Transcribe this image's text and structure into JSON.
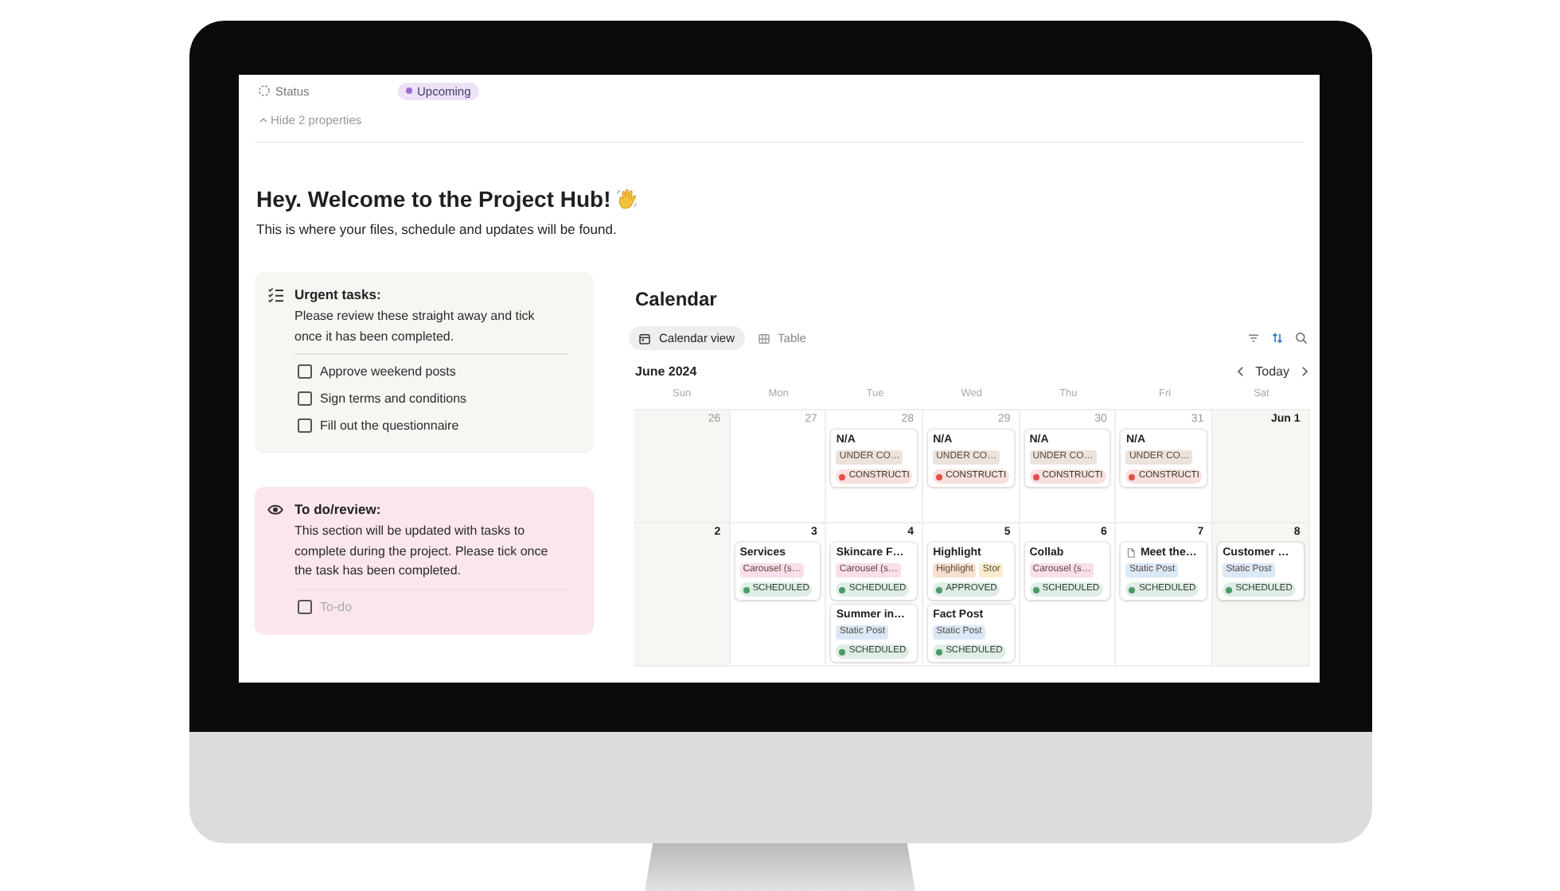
{
  "properties": {
    "status": {
      "label": "Status",
      "value": "Upcoming",
      "color": "#9a6dd7"
    },
    "toggle": "Hide 2 properties"
  },
  "hero": {
    "heading": "Hey. Welcome to the Project Hub!",
    "subtitle": "This is where your files, schedule and updates will be found."
  },
  "callouts": [
    {
      "kind": "urgent",
      "title": "Urgent tasks:",
      "text": "Please review these straight away and tick once it  has been completed.",
      "items": [
        {
          "label": "Approve weekend posts",
          "checked": false,
          "kind": "task"
        },
        {
          "label": "Sign terms and conditions",
          "checked": false,
          "kind": "task"
        },
        {
          "label": "Fill out the questionnaire",
          "checked": false,
          "kind": "task"
        }
      ]
    },
    {
      "kind": "review",
      "title": "To do/review:",
      "text": "This section will be updated with tasks to complete during the project. Please tick once the task has been completed.",
      "items": [
        {
          "label": "To-do",
          "checked": false,
          "kind": "placeholder"
        }
      ]
    }
  ],
  "calendar": {
    "title": "Calendar",
    "views": [
      {
        "label": "Calendar view",
        "kind": "calendar",
        "selected": true
      },
      {
        "label": "Table",
        "kind": "table",
        "selected": false
      }
    ],
    "month": "June 2024",
    "today": "Today",
    "weekdays": [
      "Sun",
      "Mon",
      "Tue",
      "Wed",
      "Thu",
      "Fri",
      "Sat"
    ],
    "weeks": [
      [
        {
          "day": "26",
          "in_month": false,
          "weekend": true
        },
        {
          "day": "27",
          "in_month": false,
          "weekend": false
        },
        {
          "day": "28",
          "in_month": false,
          "weekend": false,
          "events": [
            {
              "title": "N/A",
              "tags": [
                {
                  "label": "UNDER CO…",
                  "color": "#ebe3dc"
                }
              ],
              "status": {
                "label": "CONSTRUCTI",
                "color": "#e0524c"
              }
            }
          ]
        },
        {
          "day": "29",
          "in_month": false,
          "weekend": false,
          "events": [
            {
              "title": "N/A",
              "tags": [
                {
                  "label": "UNDER CO…",
                  "color": "#ebe3dc"
                }
              ],
              "status": {
                "label": "CONSTRUCTI",
                "color": "#e0524c"
              }
            }
          ]
        },
        {
          "day": "30",
          "in_month": false,
          "weekend": false,
          "events": [
            {
              "title": "N/A",
              "tags": [
                {
                  "label": "UNDER CO…",
                  "color": "#ebe3dc"
                }
              ],
              "status": {
                "label": "CONSTRUCTI",
                "color": "#e0524c"
              }
            }
          ]
        },
        {
          "day": "31",
          "in_month": false,
          "weekend": false,
          "events": [
            {
              "title": "N/A",
              "tags": [
                {
                  "label": "UNDER CO…",
                  "color": "#ebe3dc"
                }
              ],
              "status": {
                "label": "CONSTRUCTI",
                "color": "#e0524c"
              }
            }
          ]
        },
        {
          "day": "Jun 1",
          "in_month": true,
          "weekend": true
        }
      ],
      [
        {
          "day": "2",
          "in_month": true,
          "weekend": true
        },
        {
          "day": "3",
          "in_month": true,
          "weekend": false,
          "events": [
            {
              "title": "Services",
              "tags": [
                {
                  "label": "Carousel (s…",
                  "color": "#f9dfe7"
                }
              ],
              "status": {
                "label": "SCHEDULED",
                "color": "#4c9a6a"
              }
            }
          ]
        },
        {
          "day": "4",
          "in_month": true,
          "weekend": false,
          "events": [
            {
              "title": "Skincare F…",
              "tags": [
                {
                  "label": "Carousel (s…",
                  "color": "#f9dfe7"
                }
              ],
              "status": {
                "label": "SCHEDULED",
                "color": "#4c9a6a"
              }
            },
            {
              "title": "Summer in…",
              "tags": [
                {
                  "label": "Static Post",
                  "color": "#dbe9f7"
                }
              ],
              "status": {
                "label": "SCHEDULED",
                "color": "#4c9a6a"
              }
            }
          ]
        },
        {
          "day": "5",
          "in_month": true,
          "weekend": false,
          "events": [
            {
              "title": "Highlight",
              "tags": [
                {
                  "label": "Highlight",
                  "color": "#f8e0cf"
                },
                {
                  "label": "Stor",
                  "color": "#faedcc"
                }
              ],
              "status": {
                "label": "APPROVED",
                "color": "#4c9a6a"
              }
            },
            {
              "title": "Fact Post",
              "tags": [
                {
                  "label": "Static Post",
                  "color": "#dbe9f7"
                }
              ],
              "status": {
                "label": "SCHEDULED",
                "color": "#4c9a6a"
              }
            }
          ]
        },
        {
          "day": "6",
          "in_month": true,
          "weekend": false,
          "events": [
            {
              "title": "Collab",
              "tags": [
                {
                  "label": "Carousel (s…",
                  "color": "#f9dfe7"
                }
              ],
              "status": {
                "label": "SCHEDULED",
                "color": "#4c9a6a"
              }
            }
          ]
        },
        {
          "day": "7",
          "in_month": true,
          "weekend": false,
          "events": [
            {
              "title": "Meet the…",
              "kind": "page",
              "tags": [
                {
                  "label": "Static Post",
                  "color": "#dbe9f7"
                }
              ],
              "status": {
                "label": "SCHEDULED",
                "color": "#4c9a6a"
              }
            }
          ]
        },
        {
          "day": "8",
          "in_month": true,
          "weekend": true,
          "events": [
            {
              "title": "Customer …",
              "tags": [
                {
                  "label": "Static Post",
                  "color": "#dbe9f7"
                }
              ],
              "status": {
                "label": "SCHEDULED",
                "color": "#4c9a6a"
              }
            }
          ]
        }
      ]
    ]
  }
}
